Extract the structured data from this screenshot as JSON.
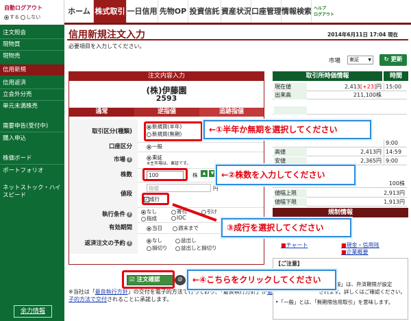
{
  "auto_logout": {
    "title": "自動ログアウト",
    "on": "する",
    "off": "しない"
  },
  "nav_tabs": [
    "ホーム",
    "株式取引",
    "一日信用",
    "先物OP",
    "投資信託",
    "資産状況",
    "口座管理",
    "情報検索"
  ],
  "help_logout": [
    "ヘルプ",
    "ログアウト"
  ],
  "sidebar": {
    "items": [
      "注文照会",
      "現物買",
      "現物売",
      "信用新規",
      "信用返済",
      "立会外分売",
      "単元未満株売"
    ],
    "items2": [
      "需要申告(受付中)",
      "購入申込"
    ],
    "items3": [
      "株価ボード",
      "ポートフォリオ"
    ],
    "items4": [
      "ネットストック・ハイスピード"
    ],
    "info_button": "余力情報"
  },
  "page": {
    "title": "信用新規注文入力",
    "datetime": "2014年6月11日 17:04 現在",
    "note": "必要項目を入力してください。",
    "market_label": "市場",
    "market_value": "東証",
    "refresh": "更新"
  },
  "order_form": {
    "header": "注文内容入力",
    "company": "(株)伊藤園",
    "code": "2593",
    "order_tabs": [
      "通常",
      "逆指値",
      "追跡指値"
    ],
    "labels": {
      "trade_type": "取引区分(種類)",
      "account": "口座区分",
      "market": "市場",
      "quantity": "株数",
      "price": "値段",
      "condition": "執行条件",
      "validity": "有効期間",
      "return_order": "返済注文の予約"
    },
    "trade_options": [
      "新規買(半年)",
      "新規買(無期)"
    ],
    "account_value": "一般",
    "market_value": "東証",
    "market_note": "※主市場は、東証です。",
    "quantity_value": "100",
    "quantity_unit": "株",
    "price_limit": "指値",
    "price_unit": "円",
    "market_order": "成行",
    "conditions": [
      "なし",
      "寄付",
      "引け",
      "指成",
      "IOC"
    ],
    "validity_options": [
      "当日",
      "週末まで"
    ],
    "return_options": [
      "なし",
      "益出し",
      "損切り",
      "益出しと損切り"
    ],
    "confirm": "注文確認",
    "footnote1": "※当社は「",
    "footnote_link1": "最良執行方針",
    "footnote2": "」の交付を電子的方法で行っており、「最良執行方針」が",
    "footnote_link2": "電子的方法で交付",
    "footnote3": "されることに承諾します。"
  },
  "market_info": {
    "header": "取引所時価情報",
    "time_header": "時間",
    "rows": [
      {
        "k": "現在値",
        "v": "2,413",
        "chg": "[+23]",
        "t": "15:00"
      },
      {
        "k": "出来高",
        "v": "211,100株",
        "chg": "",
        "t": ""
      }
    ],
    "partial_rows": [
      {
        "k": "高値",
        "v": "2,413円",
        "t": "14:59"
      },
      {
        "k": "安値",
        "v": "2,365円",
        "t": "9:00"
      }
    ],
    "row_9": "9:00",
    "unit_value": "100株",
    "limit_labels": [
      "値幅上限",
      "値幅下限"
    ],
    "limit_values": [
      "2,913円",
      "1,913円"
    ],
    "regulation_header": "規制情報",
    "links": [
      "現金・信用残",
      "チャート",
      "企業概要"
    ],
    "note_line1": "「一般」は、弁済期限が設定",
    "note_line2": "されます。詳しくはご確認ください。",
    "note_line3": "•「一般」とは、「無期限信用取引」を意味します。",
    "note_header": "【ご注意】"
  },
  "callouts": {
    "c1": "←①半年か無期を選択してください",
    "c2": "←②株数を入力してください",
    "c3": "③成行を選択してください",
    "c4": "←④こちらをクリックしてください"
  },
  "colors": {
    "accent": "#9b1b1b",
    "sidebar": "#0e6b33",
    "highlight": "#e4000f",
    "callout_border": "#2c8cdb"
  }
}
